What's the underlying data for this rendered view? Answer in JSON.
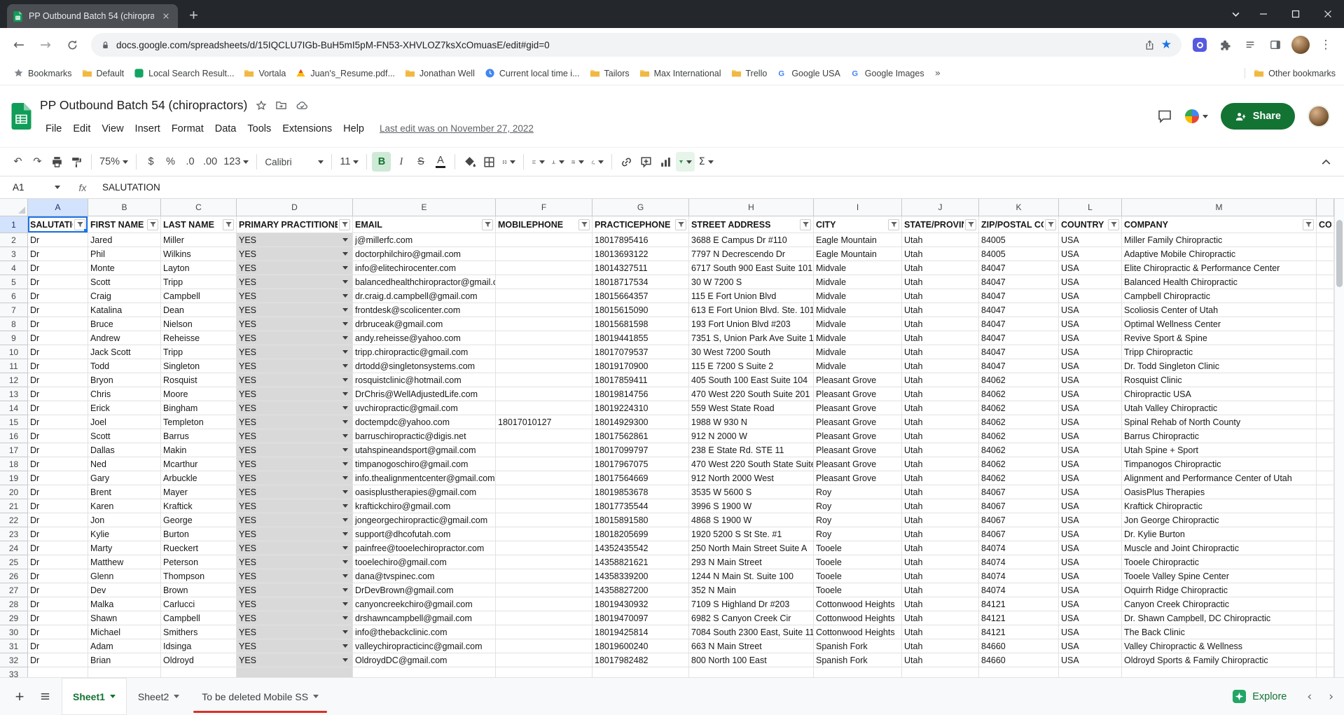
{
  "browser": {
    "tab_title": "PP Outbound Batch 54 (chiropra",
    "url": "docs.google.com/spreadsheets/d/15IQCLU7IGb-BuH5mI5pM-FN53-XHVLOZ7ksXcOmuasE/edit#gid=0",
    "bookmarks_overflow": "»",
    "other_bookmarks": "Other bookmarks",
    "bookmarks": [
      {
        "label": "Bookmarks",
        "icon": "star"
      },
      {
        "label": "Default",
        "icon": "folder"
      },
      {
        "label": "Local Search Result...",
        "icon": "site-green"
      },
      {
        "label": "Vortala",
        "icon": "folder"
      },
      {
        "label": "Juan's_Resume.pdf...",
        "icon": "drive"
      },
      {
        "label": "Jonathan Well",
        "icon": "folder"
      },
      {
        "label": "Current local time i...",
        "icon": "clock"
      },
      {
        "label": "Tailors",
        "icon": "folder"
      },
      {
        "label": "Max International",
        "icon": "folder"
      },
      {
        "label": "Trello",
        "icon": "folder"
      },
      {
        "label": "Google USA",
        "icon": "google"
      },
      {
        "label": "Google Images",
        "icon": "google"
      }
    ]
  },
  "sheets": {
    "title": "PP Outbound Batch 54 (chiropractors)",
    "menus": [
      "File",
      "Edit",
      "View",
      "Insert",
      "Format",
      "Data",
      "Tools",
      "Extensions",
      "Help"
    ],
    "last_edit": "Last edit was on November 27, 2022",
    "share_label": "Share",
    "toolbar": {
      "zoom": "75%",
      "currency": "$",
      "percent": "%",
      "decrease_decimal": ".0",
      "increase_decimal": ".00",
      "more_formats": "123",
      "font": "Calibri",
      "font_size": "11",
      "bold": "B",
      "italic": "I",
      "strikethrough": "S",
      "text_color": "A",
      "functions": "Σ"
    },
    "formula_bar": {
      "cell_ref": "A1",
      "fx": "fx",
      "value": "SALUTATION"
    },
    "grid": {
      "columns": [
        "A",
        "B",
        "C",
        "D",
        "E",
        "F",
        "G",
        "H",
        "I",
        "J",
        "K",
        "L",
        "M"
      ],
      "headers": [
        "SALUTATION",
        "FIRST NAME",
        "LAST NAME",
        "PRIMARY PRACTITIONER",
        "EMAIL",
        "MOBILEPHONE",
        "PRACTICEPHONE",
        "STREET ADDRESS",
        "CITY",
        "STATE/PROVINCI",
        "ZIP/POSTAL CODI",
        "COUNTRY",
        "COMPANY"
      ],
      "partial_header": "COM",
      "rows": [
        [
          "Dr",
          "Jared",
          "Miller",
          "YES",
          "j@millerfc.com",
          "",
          "18017895416",
          "3688 E Campus Dr #110",
          "Eagle Mountain",
          "Utah",
          "84005",
          "USA",
          "Miller Family Chiropractic"
        ],
        [
          "Dr",
          "Phil",
          "Wilkins",
          "YES",
          "doctorphilchiro@gmail.com",
          "",
          "18013693122",
          "7797 N Decrescendo Dr",
          "Eagle Mountain",
          "Utah",
          "84005",
          "USA",
          "Adaptive Mobile Chiropractic"
        ],
        [
          "Dr",
          "Monte",
          "Layton",
          "YES",
          "info@elitechirocenter.com",
          "",
          "18014327511",
          "6717 South 900 East Suite 101",
          "Midvale",
          "Utah",
          "84047",
          "USA",
          "Elite Chiropractic & Performance Center"
        ],
        [
          "Dr",
          "Scott",
          "Tripp",
          "YES",
          "balancedhealthchiropractor@gmail.c",
          "",
          "18018717534",
          "30 W 7200 S",
          "Midvale",
          "Utah",
          "84047",
          "USA",
          "Balanced Health Chiropractic"
        ],
        [
          "Dr",
          "Craig",
          "Campbell",
          "YES",
          "dr.craig.d.campbell@gmail.com",
          "",
          "18015664357",
          "115 E Fort Union Blvd",
          "Midvale",
          "Utah",
          "84047",
          "USA",
          "Campbell Chiropractic"
        ],
        [
          "Dr",
          "Katalina",
          "Dean",
          "YES",
          "frontdesk@scolicenter.com",
          "",
          "18015615090",
          "613 E Fort Union Blvd. Ste. 101",
          "Midvale",
          "Utah",
          "84047",
          "USA",
          "Scoliosis Center of Utah"
        ],
        [
          "Dr",
          "Bruce",
          "Nielson",
          "YES",
          "drbruceak@gmail.com",
          "",
          "18015681598",
          "193 Fort Union Blvd #203",
          "Midvale",
          "Utah",
          "84047",
          "USA",
          "Optimal Wellness Center"
        ],
        [
          "Dr",
          "Andrew",
          "Reheisse",
          "YES",
          "andy.reheisse@yahoo.com",
          "",
          "18019441855",
          "7351 S, Union Park Ave Suite 1",
          "Midvale",
          "Utah",
          "84047",
          "USA",
          "Revive Sport & Spine"
        ],
        [
          "Dr",
          "Jack Scott",
          "Tripp",
          "YES",
          "tripp.chiropractic@gmail.com",
          "",
          "18017079537",
          "30 West 7200 South",
          "Midvale",
          "Utah",
          "84047",
          "USA",
          "Tripp Chiropractic"
        ],
        [
          "Dr",
          "Todd",
          "Singleton",
          "YES",
          "drtodd@singletonsystems.com",
          "",
          "18019170900",
          "115 E 7200 S Suite 2",
          "Midvale",
          "Utah",
          "84047",
          "USA",
          "Dr. Todd Singleton Clinic"
        ],
        [
          "Dr",
          "Bryon",
          "Rosquist",
          "YES",
          "rosquistclinic@hotmail.com",
          "",
          "18017859411",
          "405 South 100 East Suite 104",
          "Pleasant Grove",
          "Utah",
          "84062",
          "USA",
          "Rosquist Clinic"
        ],
        [
          "Dr",
          "Chris",
          "Moore",
          "YES",
          "DrChris@WellAdjustedLife.com",
          "",
          "18019814756",
          "470 West 220 South Suite 201",
          "Pleasant Grove",
          "Utah",
          "84062",
          "USA",
          "Chiropractic USA"
        ],
        [
          "Dr",
          "Erick",
          "Bingham",
          "YES",
          "uvchiropractic@gmail.com",
          "",
          "18019224310",
          "559 West State Road",
          "Pleasant Grove",
          "Utah",
          "84062",
          "USA",
          "Utah Valley Chiropractic"
        ],
        [
          "Dr",
          "Joel",
          "Templeton",
          "YES",
          "doctempdc@yahoo.com",
          "18017010127",
          "18014929300",
          "1988 W 930 N",
          "Pleasant Grove",
          "Utah",
          "84062",
          "USA",
          "Spinal Rehab of North County"
        ],
        [
          "Dr",
          "Scott",
          "Barrus",
          "YES",
          "barruschiropractic@digis.net",
          "",
          "18017562861",
          "912 N 2000 W",
          "Pleasant Grove",
          "Utah",
          "84062",
          "USA",
          "Barrus Chiropractic"
        ],
        [
          "Dr",
          "Dallas",
          "Makin",
          "YES",
          "utahspineandsport@gmail.com",
          "",
          "18017099797",
          "238 E State Rd. STE 11",
          "Pleasant Grove",
          "Utah",
          "84062",
          "USA",
          "Utah Spine + Sport"
        ],
        [
          "Dr",
          "Ned",
          "Mcarthur",
          "YES",
          "timpanogoschiro@gmail.com",
          "",
          "18017967075",
          "470 West 220 South State Suite",
          "Pleasant Grove",
          "Utah",
          "84062",
          "USA",
          "Timpanogos Chiropractic"
        ],
        [
          "Dr",
          "Gary",
          "Arbuckle",
          "YES",
          "info.thealignmentcenter@gmail.com",
          "",
          "18017564669",
          "912 North 2000 West",
          "Pleasant Grove",
          "Utah",
          "84062",
          "USA",
          "Alignment and Performance Center of Utah"
        ],
        [
          "Dr",
          "Brent",
          "Mayer",
          "YES",
          "oasisplustherapies@gmail.com",
          "",
          "18019853678",
          "3535 W 5600 S",
          "Roy",
          "Utah",
          "84067",
          "USA",
          "OasisPlus Therapies"
        ],
        [
          "Dr",
          "Karen",
          "Kraftick",
          "YES",
          "kraftickchiro@gmail.com",
          "",
          "18017735544",
          "3996 S 1900 W",
          "Roy",
          "Utah",
          "84067",
          "USA",
          "Kraftick Chiropractic"
        ],
        [
          "Dr",
          "Jon",
          "George",
          "YES",
          "jongeorgechiropractic@gmail.com",
          "",
          "18015891580",
          "4868 S 1900 W",
          "Roy",
          "Utah",
          "84067",
          "USA",
          "Jon George Chiropractic"
        ],
        [
          "Dr",
          "Kylie",
          "Burton",
          "YES",
          "support@dhcofutah.com",
          "",
          "18018205699",
          "1920 5200 S St Ste. #1",
          "Roy",
          "Utah",
          "84067",
          "USA",
          "Dr. Kylie Burton"
        ],
        [
          "Dr",
          "Marty",
          "Rueckert",
          "YES",
          "painfree@tooelechiropractor.com",
          "",
          "14352435542",
          "250 North Main Street Suite A",
          "Tooele",
          "Utah",
          "84074",
          "USA",
          "Muscle and Joint Chiropractic"
        ],
        [
          "Dr",
          "Matthew",
          "Peterson",
          "YES",
          "tooelechiro@gmail.com",
          "",
          "14358821621",
          "293 N Main Street",
          "Tooele",
          "Utah",
          "84074",
          "USA",
          "Tooele Chiropractic"
        ],
        [
          "Dr",
          "Glenn",
          "Thompson",
          "YES",
          "dana@tvspinec.com",
          "",
          "14358339200",
          "1244 N Main St. Suite 100",
          "Tooele",
          "Utah",
          "84074",
          "USA",
          "Tooele Valley Spine Center"
        ],
        [
          "Dr",
          "Dev",
          "Brown",
          "YES",
          "DrDevBrown@gmail.com",
          "",
          "14358827200",
          "352 N Main",
          "Tooele",
          "Utah",
          "84074",
          "USA",
          "Oquirrh Ridge Chiropractic"
        ],
        [
          "Dr",
          "Malka",
          "Carlucci",
          "YES",
          "canyoncreekchiro@gmail.com",
          "",
          "18019430932",
          "7109 S Highland Dr #203",
          "Cottonwood Heights",
          "Utah",
          "84121",
          "USA",
          "Canyon Creek Chiropractic"
        ],
        [
          "Dr",
          "Shawn",
          "Campbell",
          "YES",
          "drshawncampbell@gmail.com",
          "",
          "18019470097",
          "6982 S Canyon Creek Cir",
          "Cottonwood Heights",
          "Utah",
          "84121",
          "USA",
          "Dr. Shawn Campbell, DC Chiropractic"
        ],
        [
          "Dr",
          "Michael",
          "Smithers",
          "YES",
          "info@thebackclinic.com",
          "",
          "18019425814",
          "7084 South 2300 East, Suite 11",
          "Cottonwood Heights",
          "Utah",
          "84121",
          "USA",
          "The Back Clinic"
        ],
        [
          "Dr",
          "Adam",
          "Idsinga",
          "YES",
          "valleychiropracticinc@gmail.com",
          "",
          "18019600240",
          "663 N Main Street",
          "Spanish Fork",
          "Utah",
          "84660",
          "USA",
          "Valley Chiropractic & Wellness"
        ],
        [
          "Dr",
          "Brian",
          "Oldroyd",
          "YES",
          "OldroydDC@gmail.com",
          "",
          "18017982482",
          "800 North 100 East",
          "Spanish Fork",
          "Utah",
          "84660",
          "USA",
          "Oldroyd Sports & Family Chiropractic"
        ]
      ]
    },
    "sheet_tabs": [
      {
        "label": "Sheet1",
        "active": true
      },
      {
        "label": "Sheet2",
        "active": false
      },
      {
        "label": "To be deleted Mobile SS",
        "active": false,
        "color": "#d93025"
      }
    ],
    "explore_label": "Explore"
  },
  "colors": {
    "share_green": "#137333",
    "selection_blue": "#1a73e8",
    "header_highlight": "#d3e3fd",
    "dropdown_cell_gray": "#d9d9d9",
    "sheet_tab_red": "#d93025",
    "sheets_brand_green": "#0f9d58"
  }
}
